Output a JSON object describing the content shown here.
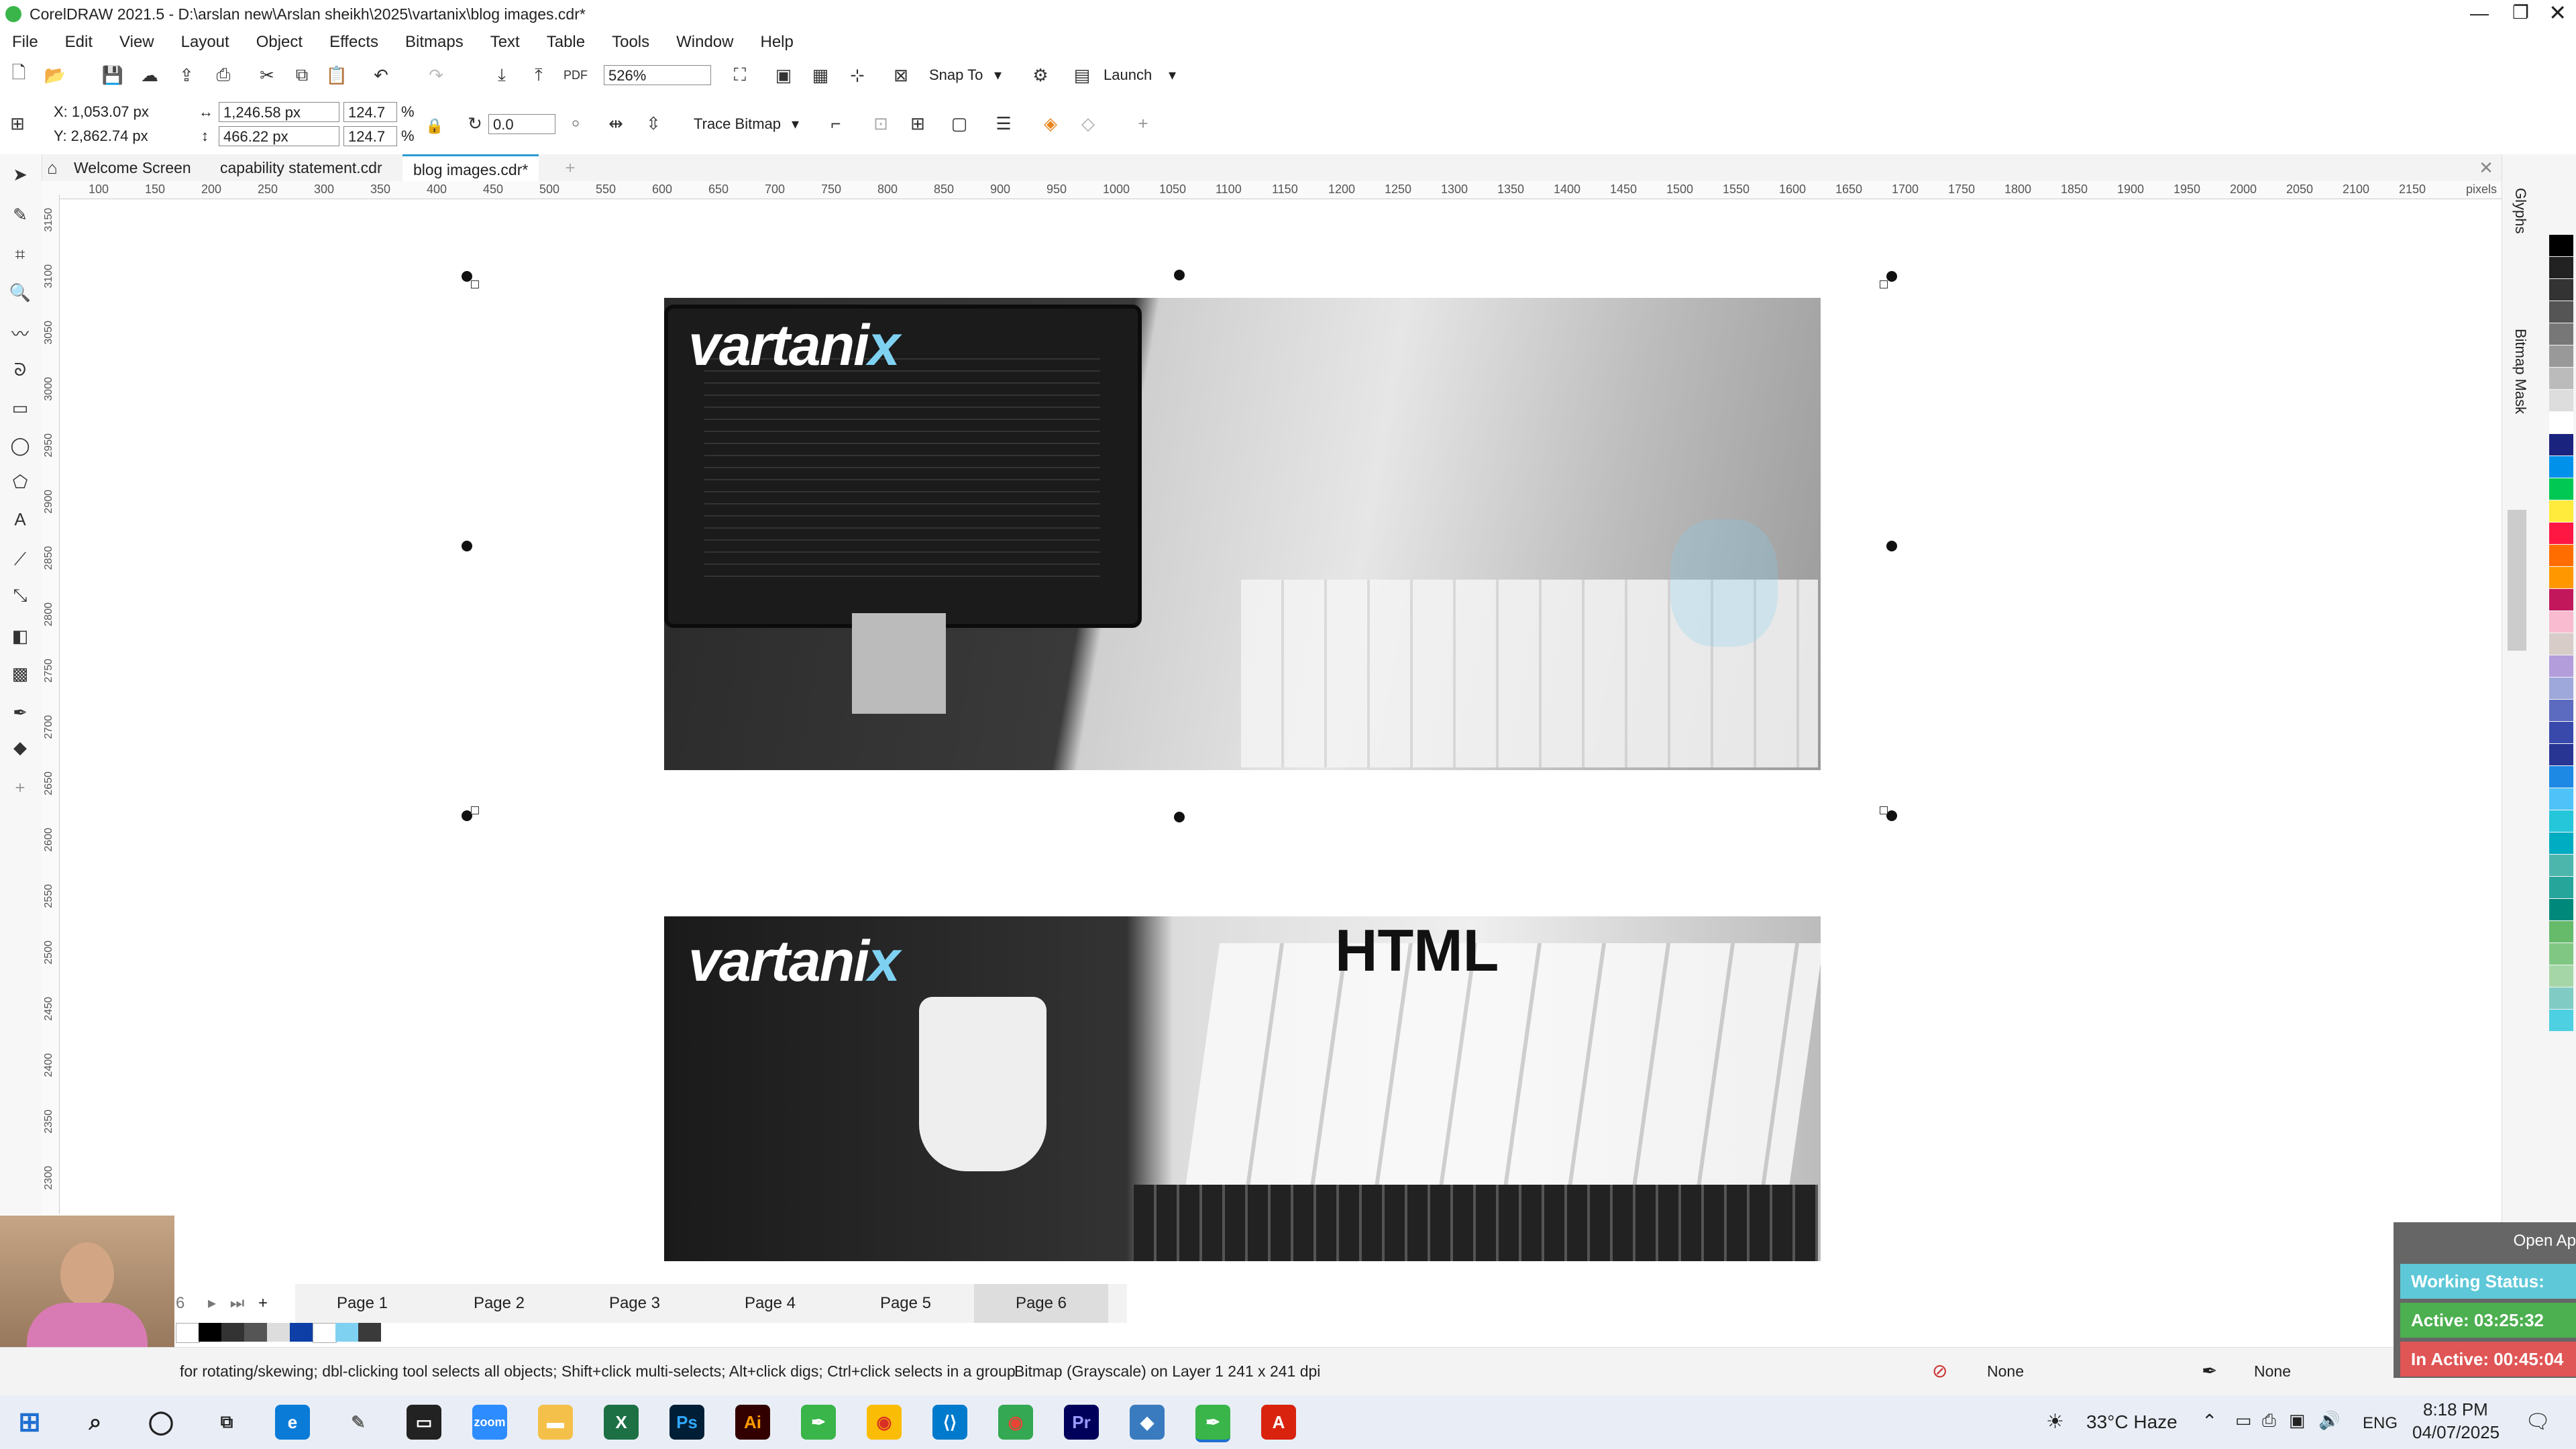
{
  "titlebar": {
    "title": "CorelDRAW 2021.5 - D:\\arslan new\\Arslan sheikh\\2025\\vartanix\\blog images.cdr*"
  },
  "menu": [
    "File",
    "Edit",
    "View",
    "Layout",
    "Object",
    "Effects",
    "Bitmaps",
    "Text",
    "Table",
    "Tools",
    "Window",
    "Help"
  ],
  "toolbar": {
    "zoom": "526%",
    "snap_to": "Snap To",
    "launch": "Launch"
  },
  "properties": {
    "x": "X: 1,053.07 px",
    "y": "Y: 2,862.74 px",
    "width": "1,246.58 px",
    "height": "466.22 px",
    "scale_w": "124.7",
    "scale_h": "124.7",
    "percent": "%",
    "rotation": "0.0",
    "trace_bitmap": "Trace Bitmap"
  },
  "tabs": [
    "Welcome Screen",
    "capability statement.cdr",
    "blog images.cdr*"
  ],
  "ruler": {
    "h_ticks": [
      "100",
      "150",
      "200",
      "250",
      "300",
      "350",
      "400",
      "450",
      "500",
      "550",
      "600",
      "650",
      "700",
      "750",
      "800",
      "850",
      "900",
      "950",
      "1000",
      "1050",
      "1100",
      "1150",
      "1200",
      "1250",
      "1300",
      "1350",
      "1400",
      "1450",
      "1500",
      "1550",
      "1600",
      "1650",
      "1700",
      "1750",
      "1800",
      "1850",
      "1900",
      "1950",
      "2000",
      "2050",
      "2100",
      "2150"
    ],
    "unit": "pixels",
    "v_ticks": [
      "3150",
      "3100",
      "3050",
      "3000",
      "2950",
      "2900",
      "2850",
      "2800",
      "2750",
      "2700",
      "2650",
      "2600",
      "2550",
      "2500",
      "2450",
      "2400",
      "2350",
      "2300"
    ]
  },
  "canvas": {
    "logo_text": "vartani",
    "logo_accent": "x",
    "html_label": "HTML"
  },
  "right_panel": {
    "glyphs": "Glyphs",
    "bitmap_mask": "Bitmap Mask"
  },
  "pages": {
    "current_num": "6",
    "add": "+",
    "list": [
      "Page 1",
      "Page 2",
      "Page 3",
      "Page 4",
      "Page 5",
      "Page 6"
    ],
    "active": "Page 6"
  },
  "status": {
    "hint": "for rotating/skewing; dbl-clicking tool selects all objects; Shift+click multi-selects; Alt+click digs; Ctrl+click selects in a group",
    "object": "Bitmap (Grayscale) on Layer 1 241 x 241 dpi",
    "fill": "None",
    "outline": "None"
  },
  "overlay": {
    "open": "Open Ap",
    "working": "Working Status: Active",
    "active": "Active: 03:25:32",
    "inactive": "In Active: 00:45:04"
  },
  "taskbar": {
    "weather": "33°C  Haze",
    "lang": "ENG",
    "time": "8:18 PM",
    "date": "04/07/2025"
  },
  "colors": {
    "accent": "#7fd1f2",
    "active_green": "#4caf50",
    "inactive_red": "#e05555",
    "working_teal": "#5ec8d8"
  },
  "palette": [
    "#000000",
    "#222222",
    "#333333",
    "#555555",
    "#777777",
    "#999999",
    "#bbbbbb",
    "#dddddd",
    "#ffffff",
    "#1a237e",
    "#0091ea",
    "#00c853",
    "#ffeb3b",
    "#ff1744",
    "#ff6d00",
    "#ff9800",
    "#c2185b",
    "#f8bbd0",
    "#d7ccc8",
    "#b39ddb",
    "#9fa8da",
    "#5c6bc0",
    "#3949ab",
    "#283593",
    "#1e88e5",
    "#4fc3f7",
    "#26c6da",
    "#00acc1",
    "#4db6ac",
    "#26a69a",
    "#00897b",
    "#66bb6a",
    "#81c784",
    "#a5d6a7",
    "#80cbc4",
    "#4dd0e1"
  ]
}
